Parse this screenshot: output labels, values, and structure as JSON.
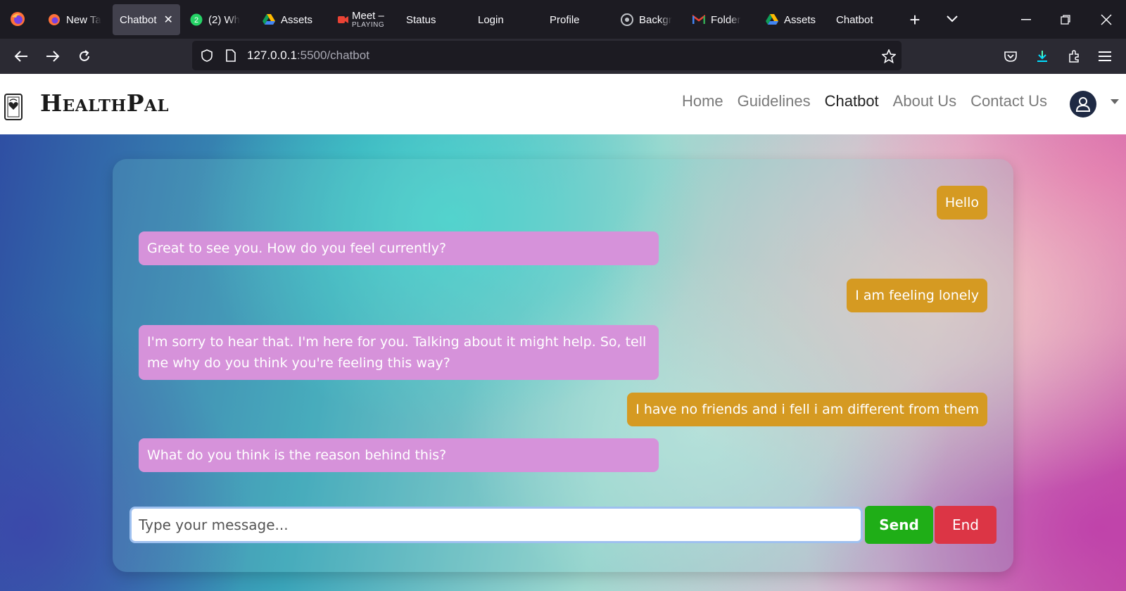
{
  "browser": {
    "tabs": [
      {
        "label": "New Ta",
        "icon": "firefox-icon"
      },
      {
        "label": "Chatbot",
        "icon": "",
        "active": true
      },
      {
        "label": "(2) Wh",
        "icon": "whatsapp-icon"
      },
      {
        "label": "Assets",
        "icon": "google-drive-icon"
      },
      {
        "label": "Meet –",
        "sublabel": "PLAYING",
        "icon": "meet-audio-icon"
      },
      {
        "label": "Status",
        "icon": ""
      },
      {
        "label": "Login",
        "icon": ""
      },
      {
        "label": "Profile",
        "icon": ""
      },
      {
        "label": "Backgr",
        "icon": "openai-icon"
      },
      {
        "label": "Folder",
        "icon": "gmail-icon"
      },
      {
        "label": "Assets",
        "icon": "google-drive-icon"
      },
      {
        "label": "Chatbot",
        "icon": ""
      }
    ],
    "url_host": "127.0.0.1",
    "url_path": ":5500/chatbot"
  },
  "site": {
    "brand": "HealthPal",
    "nav": [
      "Home",
      "Guidelines",
      "Chatbot",
      "About Us",
      "Contact Us"
    ],
    "active_nav": "Chatbot"
  },
  "chat": {
    "messages": [
      {
        "sender": "user",
        "text": "Hello"
      },
      {
        "sender": "bot",
        "text": "Great to see you. How do you feel currently?"
      },
      {
        "sender": "user",
        "text": "I am feeling lonely"
      },
      {
        "sender": "bot",
        "text": "I'm sorry to hear that. I'm here for you. Talking about it might help. So, tell me why do you think you're feeling this way?"
      },
      {
        "sender": "user",
        "text": "I have no friends and i fell i am different from them"
      },
      {
        "sender": "bot",
        "text": "What do you think is the reason behind this?"
      }
    ],
    "input_placeholder": "Type your message...",
    "input_value": "",
    "send_label": "Send",
    "end_label": "End"
  },
  "colors": {
    "user_bubble": "#d59a22",
    "bot_bubble": "#d692da",
    "send_button": "#1fae17",
    "end_button": "#dc3545"
  }
}
